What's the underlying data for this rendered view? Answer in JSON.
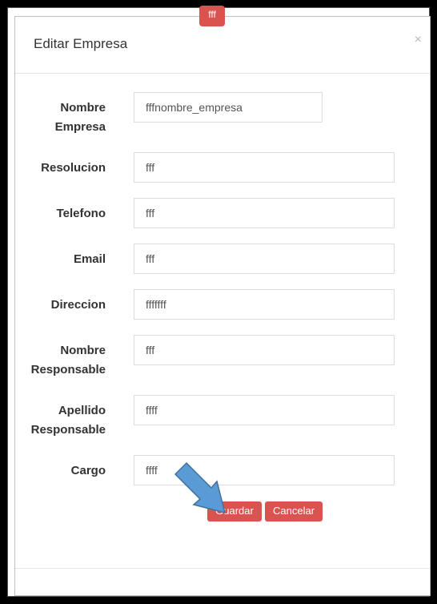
{
  "modal": {
    "title": "Editar Empresa",
    "close_symbol": "×",
    "badge": "fff"
  },
  "form": {
    "nombre_empresa": {
      "label_line1": "Nombre",
      "label_line2": "Empresa",
      "value": "fffnombre_empresa"
    },
    "resolucion": {
      "label": "Resolucion",
      "value": "fff"
    },
    "telefono": {
      "label": "Telefono",
      "value": "fff"
    },
    "email": {
      "label": "Email",
      "value": "fff"
    },
    "direccion": {
      "label": "Direccion",
      "value": "fffffff"
    },
    "nombre_responsable": {
      "label_line1": "Nombre",
      "label_line2": "Responsable",
      "value": "fff"
    },
    "apellido_responsable": {
      "label_line1": "Apellido",
      "label_line2": "Responsable",
      "value": "ffff"
    },
    "cargo": {
      "label": "Cargo",
      "value": "ffff"
    }
  },
  "buttons": {
    "guardar": "Guardar",
    "cancelar": "Cancelar"
  },
  "colors": {
    "danger": "#d9534f",
    "arrow_fill": "#5b9bd5",
    "arrow_stroke": "#41719c"
  }
}
